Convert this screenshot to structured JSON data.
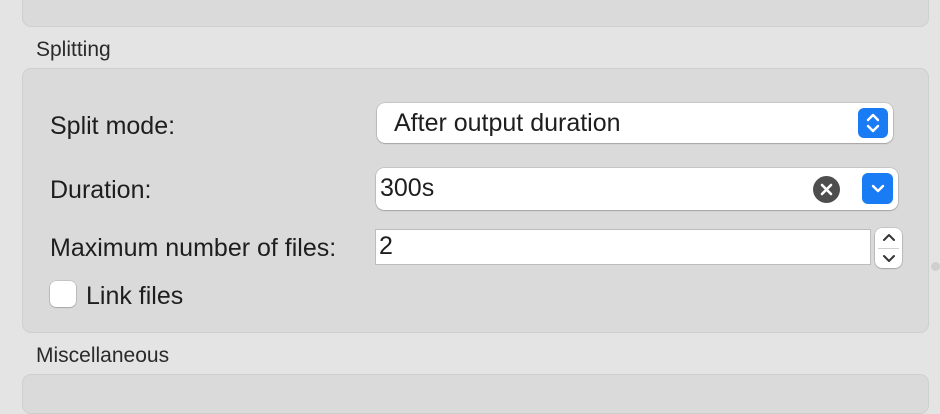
{
  "sections": {
    "splitting_title": "Splitting",
    "misc_title": "Miscellaneous"
  },
  "split_mode": {
    "label": "Split mode:",
    "value": "After output duration",
    "icon": "up-down-chevron-icon"
  },
  "duration": {
    "label": "Duration:",
    "value": "300s",
    "clear_icon": "clear-circle-icon",
    "dropdown_icon": "chevron-down-icon"
  },
  "max_files": {
    "label": "Maximum number of files:",
    "value": "2",
    "stepper_icons": [
      "chevron-up-icon",
      "chevron-down-icon"
    ]
  },
  "link_files": {
    "label": "Link files",
    "checked": false
  },
  "colors": {
    "accent": "#1a7cf5",
    "panel": "#dadada",
    "window": "#e4e4e4"
  }
}
